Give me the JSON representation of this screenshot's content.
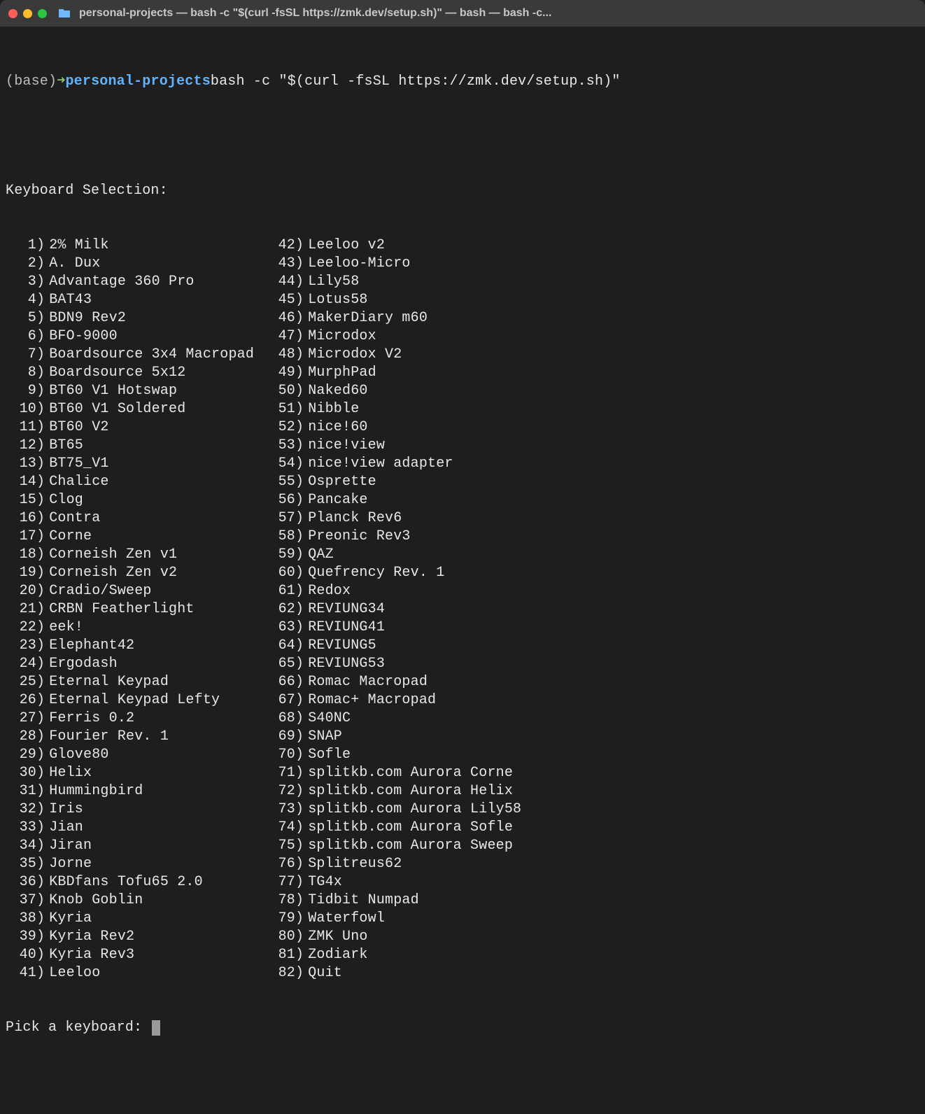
{
  "window": {
    "title": "personal-projects — bash -c \"$(curl -fsSL https://zmk.dev/setup.sh)\" — bash — bash -c..."
  },
  "prompt": {
    "base": "(base)",
    "arrow": "➜",
    "dir": "personal-projects",
    "command": "bash -c \"$(curl -fsSL https://zmk.dev/setup.sh)\""
  },
  "heading": "Keyboard Selection:",
  "keyboards_col1": [
    {
      "n": "1",
      "name": "2% Milk"
    },
    {
      "n": "2",
      "name": "A. Dux"
    },
    {
      "n": "3",
      "name": "Advantage 360 Pro"
    },
    {
      "n": "4",
      "name": "BAT43"
    },
    {
      "n": "5",
      "name": "BDN9 Rev2"
    },
    {
      "n": "6",
      "name": "BFO-9000"
    },
    {
      "n": "7",
      "name": "Boardsource 3x4 Macropad"
    },
    {
      "n": "8",
      "name": "Boardsource 5x12"
    },
    {
      "n": "9",
      "name": "BT60 V1 Hotswap"
    },
    {
      "n": "10",
      "name": "BT60 V1 Soldered"
    },
    {
      "n": "11",
      "name": "BT60 V2"
    },
    {
      "n": "12",
      "name": "BT65"
    },
    {
      "n": "13",
      "name": "BT75_V1"
    },
    {
      "n": "14",
      "name": "Chalice"
    },
    {
      "n": "15",
      "name": "Clog"
    },
    {
      "n": "16",
      "name": "Contra"
    },
    {
      "n": "17",
      "name": "Corne"
    },
    {
      "n": "18",
      "name": "Corneish Zen v1"
    },
    {
      "n": "19",
      "name": "Corneish Zen v2"
    },
    {
      "n": "20",
      "name": "Cradio/Sweep"
    },
    {
      "n": "21",
      "name": "CRBN Featherlight"
    },
    {
      "n": "22",
      "name": "eek!"
    },
    {
      "n": "23",
      "name": "Elephant42"
    },
    {
      "n": "24",
      "name": "Ergodash"
    },
    {
      "n": "25",
      "name": "Eternal Keypad"
    },
    {
      "n": "26",
      "name": "Eternal Keypad Lefty"
    },
    {
      "n": "27",
      "name": "Ferris 0.2"
    },
    {
      "n": "28",
      "name": "Fourier Rev. 1"
    },
    {
      "n": "29",
      "name": "Glove80"
    },
    {
      "n": "30",
      "name": "Helix"
    },
    {
      "n": "31",
      "name": "Hummingbird"
    },
    {
      "n": "32",
      "name": "Iris"
    },
    {
      "n": "33",
      "name": "Jian"
    },
    {
      "n": "34",
      "name": "Jiran"
    },
    {
      "n": "35",
      "name": "Jorne"
    },
    {
      "n": "36",
      "name": "KBDfans Tofu65 2.0"
    },
    {
      "n": "37",
      "name": "Knob Goblin"
    },
    {
      "n": "38",
      "name": "Kyria"
    },
    {
      "n": "39",
      "name": "Kyria Rev2"
    },
    {
      "n": "40",
      "name": "Kyria Rev3"
    },
    {
      "n": "41",
      "name": "Leeloo"
    }
  ],
  "keyboards_col2": [
    {
      "n": "42",
      "name": "Leeloo v2"
    },
    {
      "n": "43",
      "name": "Leeloo-Micro"
    },
    {
      "n": "44",
      "name": "Lily58"
    },
    {
      "n": "45",
      "name": "Lotus58"
    },
    {
      "n": "46",
      "name": "MakerDiary m60"
    },
    {
      "n": "47",
      "name": "Microdox"
    },
    {
      "n": "48",
      "name": "Microdox V2"
    },
    {
      "n": "49",
      "name": "MurphPad"
    },
    {
      "n": "50",
      "name": "Naked60"
    },
    {
      "n": "51",
      "name": "Nibble"
    },
    {
      "n": "52",
      "name": "nice!60"
    },
    {
      "n": "53",
      "name": "nice!view"
    },
    {
      "n": "54",
      "name": "nice!view adapter"
    },
    {
      "n": "55",
      "name": "Osprette"
    },
    {
      "n": "56",
      "name": "Pancake"
    },
    {
      "n": "57",
      "name": "Planck Rev6"
    },
    {
      "n": "58",
      "name": "Preonic Rev3"
    },
    {
      "n": "59",
      "name": "QAZ"
    },
    {
      "n": "60",
      "name": "Quefrency Rev. 1"
    },
    {
      "n": "61",
      "name": "Redox"
    },
    {
      "n": "62",
      "name": "REVIUNG34"
    },
    {
      "n": "63",
      "name": "REVIUNG41"
    },
    {
      "n": "64",
      "name": "REVIUNG5"
    },
    {
      "n": "65",
      "name": "REVIUNG53"
    },
    {
      "n": "66",
      "name": "Romac Macropad"
    },
    {
      "n": "67",
      "name": "Romac+ Macropad"
    },
    {
      "n": "68",
      "name": "S40NC"
    },
    {
      "n": "69",
      "name": "SNAP"
    },
    {
      "n": "70",
      "name": "Sofle"
    },
    {
      "n": "71",
      "name": "splitkb.com Aurora Corne"
    },
    {
      "n": "72",
      "name": "splitkb.com Aurora Helix"
    },
    {
      "n": "73",
      "name": "splitkb.com Aurora Lily58"
    },
    {
      "n": "74",
      "name": "splitkb.com Aurora Sofle"
    },
    {
      "n": "75",
      "name": "splitkb.com Aurora Sweep"
    },
    {
      "n": "76",
      "name": "Splitreus62"
    },
    {
      "n": "77",
      "name": "TG4x"
    },
    {
      "n": "78",
      "name": "Tidbit Numpad"
    },
    {
      "n": "79",
      "name": "Waterfowl"
    },
    {
      "n": "80",
      "name": "ZMK Uno"
    },
    {
      "n": "81",
      "name": "Zodiark"
    },
    {
      "n": "82",
      "name": "Quit"
    }
  ],
  "pick_prompt": "Pick a keyboard: "
}
